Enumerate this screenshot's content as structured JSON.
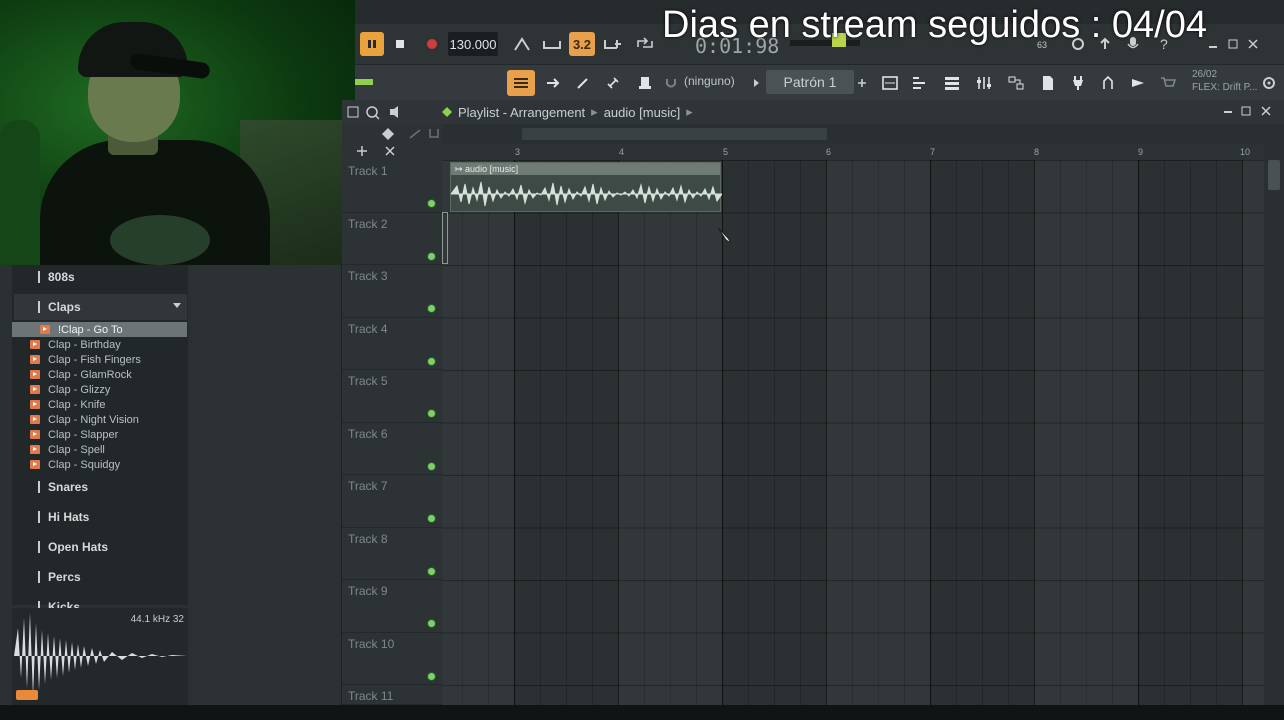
{
  "stream_banner": "Dias en stream seguidos : 04/04",
  "transport": {
    "tempo": "130.000",
    "time_display": "0:01:98",
    "pattern_mode_label": "3.2",
    "snap": "(ninguno)",
    "pattern": "Patrón 1",
    "cpu_info": "63",
    "flex_date": "26/02",
    "flex_label": "FLEX: Drift P..."
  },
  "browser": {
    "folders": [
      "808s",
      "Claps",
      "Snares",
      "Hi Hats",
      "Open Hats",
      "Percs",
      "Kicks"
    ],
    "selected_file": "!Clap - Go To",
    "files": [
      "Clap - Birthday",
      "Clap - Fish Fingers",
      "Clap - GlamRock",
      "Clap - Glizzy",
      "Clap - Knife",
      "Clap - Night Vision",
      "Clap - Slapper",
      "Clap - Spell",
      "Clap - Squidgy"
    ],
    "sample_info": "44.1 kHz 32"
  },
  "playlist": {
    "title": "Playlist - Arrangement",
    "current_clip": "audio [music]",
    "ruler": [
      "3",
      "4",
      "5",
      "6",
      "7",
      "8",
      "9",
      "10"
    ],
    "tracks": [
      "Track 1",
      "Track 2",
      "Track 3",
      "Track 4",
      "Track 5",
      "Track 6",
      "Track 7",
      "Track 8",
      "Track 9",
      "Track 10",
      "Track 11"
    ],
    "clip_label": "audio [music]"
  },
  "colors": {
    "accent_orange": "#e8a04a",
    "track_led": "#7ccf6a",
    "webcam_tint": "#1f6a22",
    "clip": "#6e7c75"
  }
}
